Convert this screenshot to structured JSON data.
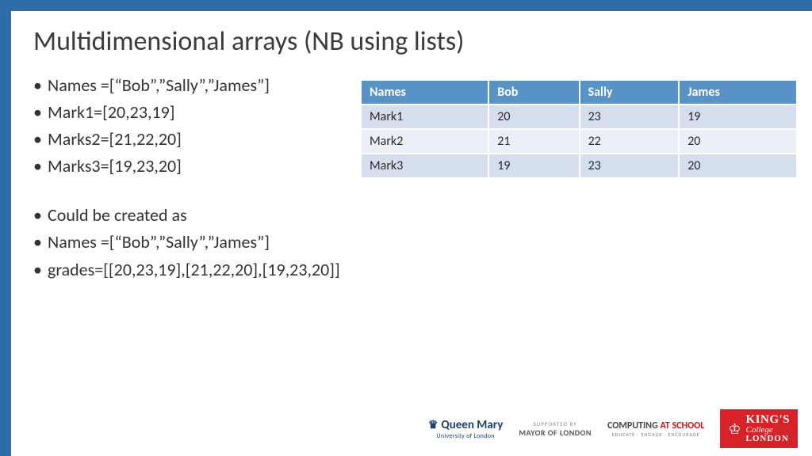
{
  "title": "Multidimensional arrays (NB using lists)",
  "bullets": {
    "b1": "Names =[“Bob”,”Sally”,”James”]",
    "b2": "Mark1=[20,23,19]",
    "b3": "Marks2=[21,22,20]",
    "b4": "Marks3=[19,23,20]",
    "b5": "Could be created as",
    "b6": "Names =[“Bob”,”Sally”,”James”]",
    "b7": "grades=[[20,23,19],[21,22,20],[19,23,20]]"
  },
  "table": {
    "headers": {
      "h1": "Names",
      "h2": "Bob",
      "h3": "Sally",
      "h4": "James"
    },
    "rows": [
      {
        "label": "Mark1",
        "c1": "20",
        "c2": "23",
        "c3": "19"
      },
      {
        "label": "Mark2",
        "c1": "21",
        "c2": "22",
        "c3": "20"
      },
      {
        "label": "Mark3",
        "c1": "19",
        "c2": "23",
        "c3": "20"
      }
    ]
  },
  "footer": {
    "qm_main": "Queen Mary",
    "qm_sub": "University of London",
    "mayor_sup": "SUPPORTED BY",
    "mayor_main": "MAYOR OF LONDON",
    "cas_comp": "COMPUTING ",
    "cas_at": "AT SCHOOL",
    "cas_sub": "EDUCATE · ENGAGE · ENCOURAGE",
    "kcl_kings": "KING'S",
    "kcl_college": "College",
    "kcl_london": "LONDON"
  },
  "chart_data": {
    "type": "table",
    "columns": [
      "Names",
      "Bob",
      "Sally",
      "James"
    ],
    "rows": [
      [
        "Mark1",
        20,
        23,
        19
      ],
      [
        "Mark2",
        21,
        22,
        20
      ],
      [
        "Mark3",
        19,
        23,
        20
      ]
    ]
  }
}
